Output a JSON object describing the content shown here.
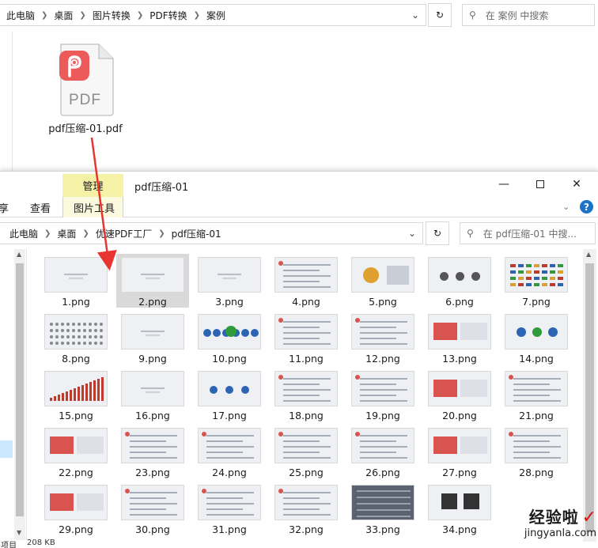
{
  "background_window": {
    "breadcrumbs": [
      "此电脑",
      "桌面",
      "图片转换",
      "PDF转换",
      "案例"
    ],
    "search_placeholder": "在 案例 中搜索",
    "file": {
      "name": "pdf压缩-01.pdf",
      "icon_label": "PDF",
      "icon": "pdf-logo-icon"
    }
  },
  "foreground_window": {
    "title": "pdf压缩-01",
    "context_tab": "管理",
    "ribbon_tabs": [
      "享",
      "查看",
      "图片工具"
    ],
    "breadcrumbs": [
      "此电脑",
      "桌面",
      "优速PDF工厂",
      "pdf压缩-01"
    ],
    "search_placeholder": "在 pdf压缩-01 中搜...",
    "files": [
      "1.png",
      "2.png",
      "3.png",
      "4.png",
      "5.png",
      "6.png",
      "7.png",
      "8.png",
      "9.png",
      "10.png",
      "11.png",
      "12.png",
      "13.png",
      "14.png",
      "15.png",
      "16.png",
      "17.png",
      "18.png",
      "19.png",
      "20.png",
      "21.png",
      "22.png",
      "23.png",
      "24.png",
      "25.png",
      "26.png",
      "27.png",
      "28.png",
      "29.png",
      "30.png",
      "31.png",
      "32.png",
      "33.png",
      "34.png"
    ],
    "selected_file": "2.png",
    "status": {
      "items": "·项目",
      "size": "208 KB"
    }
  },
  "watermark": {
    "text": "经验啦",
    "check": "✓",
    "url": "jingyanla.com"
  },
  "colors": {
    "context_tab": "#f5f1a6",
    "selection": "#d9d9d9",
    "arrow": "#e8352f",
    "pdf_icon": "#ec5a5a"
  }
}
